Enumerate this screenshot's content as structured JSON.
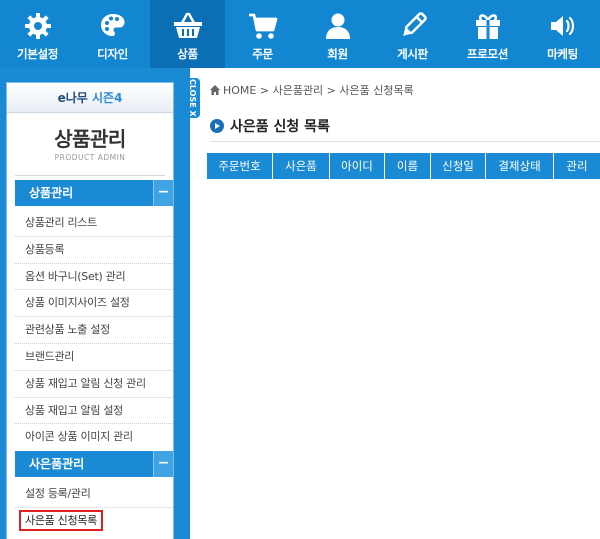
{
  "nav": {
    "items": [
      {
        "label": "기본설정",
        "icon": "gear-icon"
      },
      {
        "label": "디자인",
        "icon": "palette-icon"
      },
      {
        "label": "상품",
        "icon": "basket-icon",
        "active": true
      },
      {
        "label": "주문",
        "icon": "cart-icon"
      },
      {
        "label": "회원",
        "icon": "person-icon"
      },
      {
        "label": "게시판",
        "icon": "pencil-icon"
      },
      {
        "label": "프로모션",
        "icon": "gift-icon"
      },
      {
        "label": "마케팅",
        "icon": "speaker-icon"
      }
    ]
  },
  "sidebar": {
    "brand_prefix": "e나무 ",
    "brand_accent": "시즌4",
    "title": "상품관리",
    "subtitle": "PRODUCT ADMIN",
    "close_label": "CLOSE X",
    "sections": [
      {
        "title": "상품관리",
        "toggle": "−",
        "items": [
          "상품관리 리스트",
          "상품등록",
          "옵션 바구니(Set) 관리",
          "상품 이미지사이즈 설정",
          "관련상품 노출 설정",
          "브랜드관리",
          "상품 재입고 알림 신청 관리",
          "상품 재입고 알림 설정",
          "아이콘 상품 이미지 관리"
        ]
      },
      {
        "title": "사은품관리",
        "toggle": "−",
        "items": [
          "설정 등록/관리",
          "사은품 신청목록"
        ]
      }
    ]
  },
  "main": {
    "breadcrumb": "HOME > 사은품관리 > 사은품 신청목록",
    "title": "사은품 신청 목록",
    "columns": [
      "주문번호",
      "사은품",
      "아이디",
      "이름",
      "신청일",
      "결제상태",
      "관리"
    ]
  },
  "colors": {
    "nav_bg": "#1286d1",
    "accent": "#1a8ad4",
    "highlight": "#e02020"
  }
}
